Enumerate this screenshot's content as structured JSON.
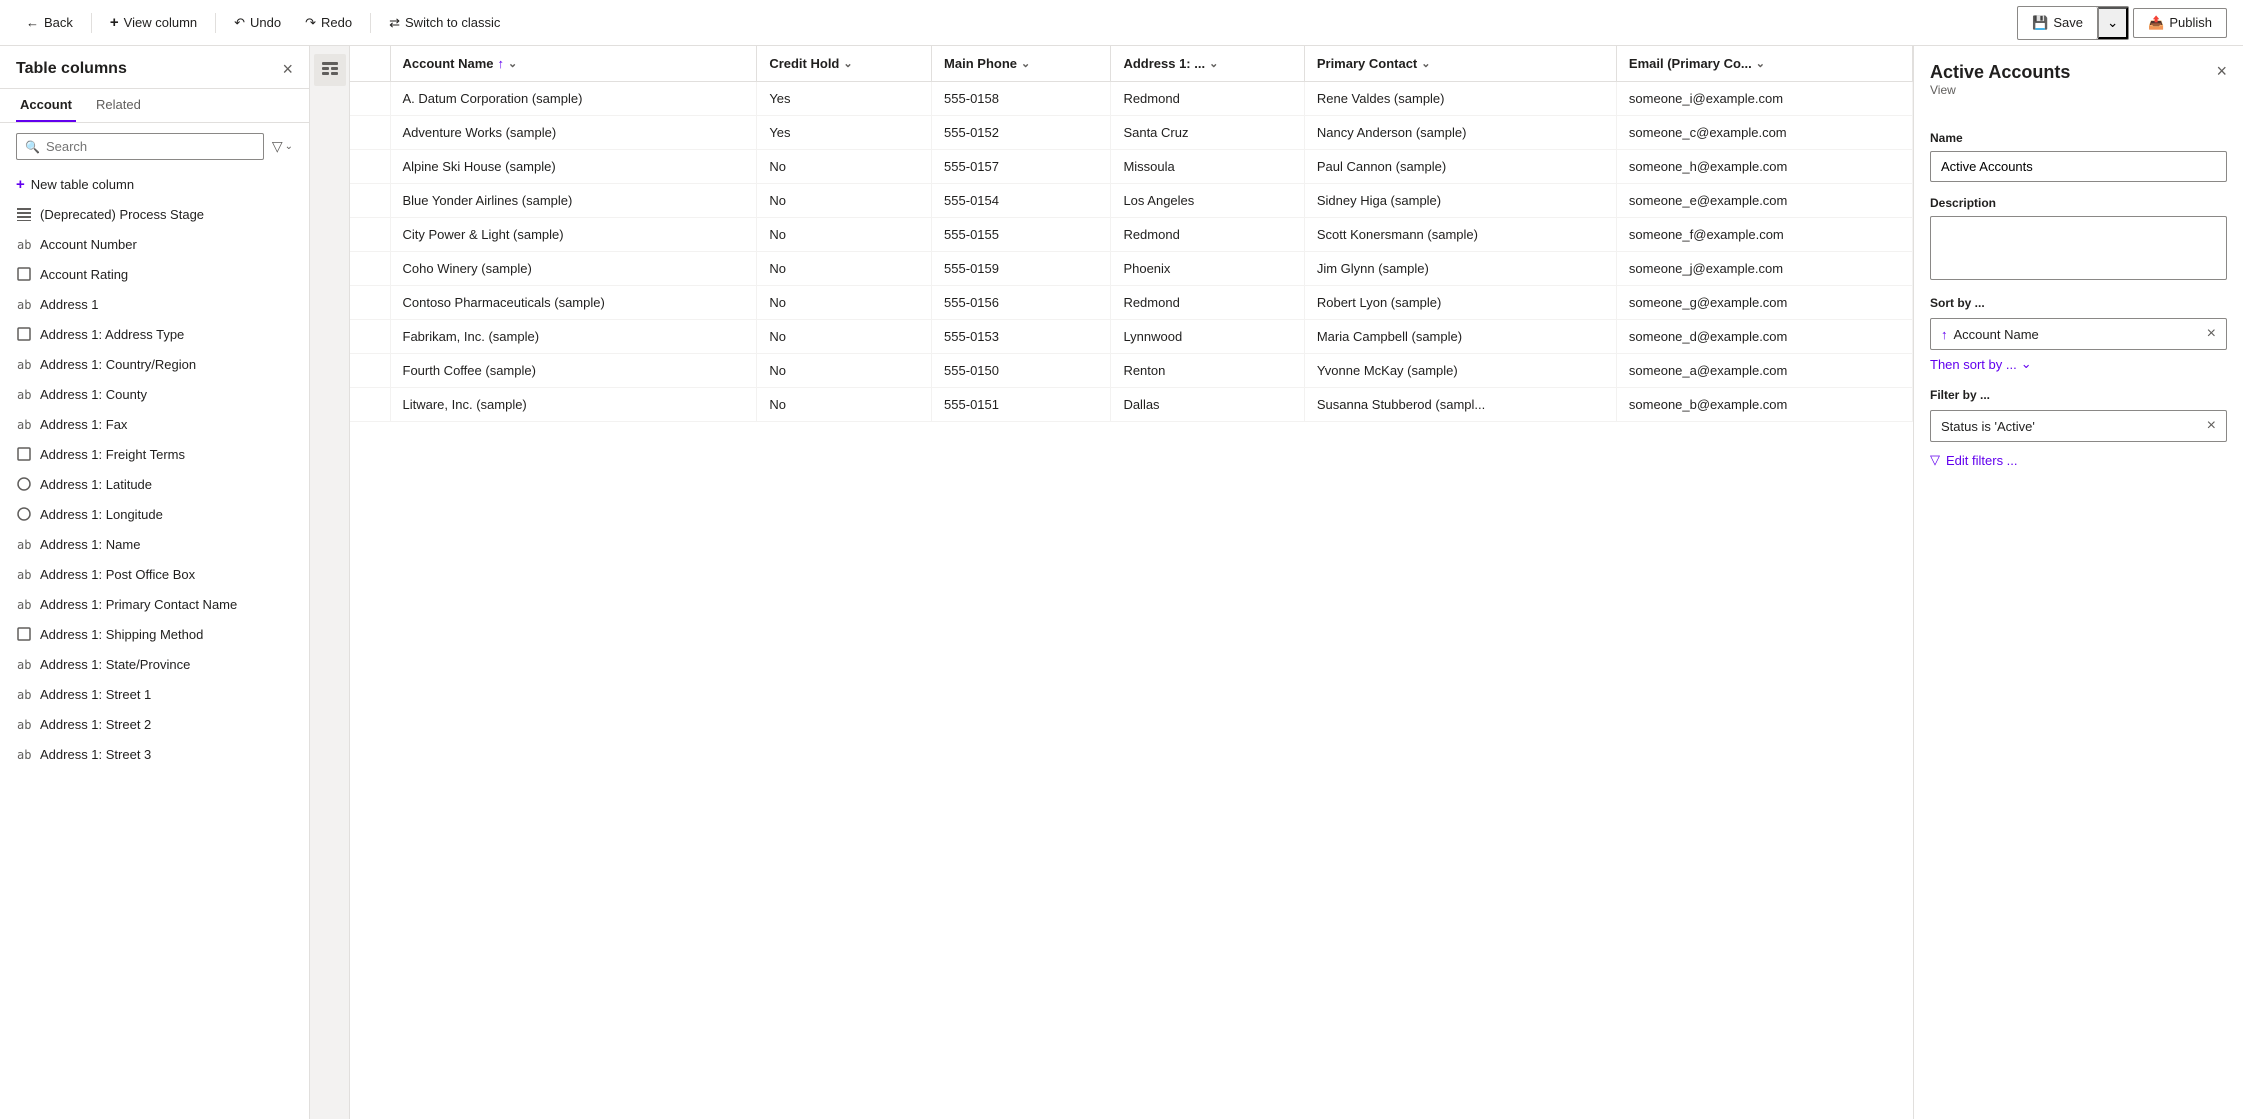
{
  "toolbar": {
    "back_label": "Back",
    "view_column_label": "View column",
    "undo_label": "Undo",
    "redo_label": "Redo",
    "switch_label": "Switch to classic",
    "save_label": "Save",
    "publish_label": "Publish"
  },
  "left_panel": {
    "title": "Table columns",
    "close_label": "×",
    "tabs": [
      {
        "id": "account",
        "label": "Account",
        "active": true
      },
      {
        "id": "related",
        "label": "Related",
        "active": false
      }
    ],
    "search_placeholder": "Search",
    "new_column_label": "New table column",
    "columns": [
      {
        "id": "col-deprecated-process",
        "icon": "list",
        "label": "(Deprecated) Process Stage"
      },
      {
        "id": "col-account-number",
        "icon": "text",
        "label": "Account Number"
      },
      {
        "id": "col-account-rating",
        "icon": "box",
        "label": "Account Rating"
      },
      {
        "id": "col-address-1",
        "icon": "text",
        "label": "Address 1"
      },
      {
        "id": "col-address-1-type",
        "icon": "box",
        "label": "Address 1: Address Type"
      },
      {
        "id": "col-address-1-country",
        "icon": "text",
        "label": "Address 1: Country/Region"
      },
      {
        "id": "col-address-1-county",
        "icon": "text",
        "label": "Address 1: County"
      },
      {
        "id": "col-address-1-fax",
        "icon": "text",
        "label": "Address 1: Fax"
      },
      {
        "id": "col-address-1-freight",
        "icon": "box",
        "label": "Address 1: Freight Terms"
      },
      {
        "id": "col-address-1-latitude",
        "icon": "circle",
        "label": "Address 1: Latitude"
      },
      {
        "id": "col-address-1-longitude",
        "icon": "circle",
        "label": "Address 1: Longitude"
      },
      {
        "id": "col-address-1-name",
        "icon": "text",
        "label": "Address 1: Name"
      },
      {
        "id": "col-address-1-pobox",
        "icon": "text",
        "label": "Address 1: Post Office Box"
      },
      {
        "id": "col-address-1-primary-contact",
        "icon": "text",
        "label": "Address 1: Primary Contact Name"
      },
      {
        "id": "col-address-1-shipping",
        "icon": "box",
        "label": "Address 1: Shipping Method"
      },
      {
        "id": "col-address-1-state",
        "icon": "text",
        "label": "Address 1: State/Province"
      },
      {
        "id": "col-address-1-street1",
        "icon": "text",
        "label": "Address 1: Street 1"
      },
      {
        "id": "col-address-1-street2",
        "icon": "text",
        "label": "Address 1: Street 2"
      },
      {
        "id": "col-address-1-street3",
        "icon": "text",
        "label": "Address 1: Street 3"
      }
    ]
  },
  "grid": {
    "columns": [
      {
        "id": "account-name",
        "label": "Account Name",
        "sort": "asc",
        "has_filter": true
      },
      {
        "id": "credit-hold",
        "label": "Credit Hold",
        "has_filter": true
      },
      {
        "id": "main-phone",
        "label": "Main Phone",
        "has_filter": true
      },
      {
        "id": "address-1",
        "label": "Address 1: ...",
        "has_filter": true
      },
      {
        "id": "primary-contact",
        "label": "Primary Contact",
        "has_filter": true
      },
      {
        "id": "email",
        "label": "Email (Primary Co...",
        "has_filter": true
      }
    ],
    "rows": [
      {
        "account_name": "A. Datum Corporation (sample)",
        "credit_hold": "Yes",
        "main_phone": "555-0158",
        "address": "Redmond",
        "primary_contact": "Rene Valdes (sample)",
        "email": "someone_i@example.com"
      },
      {
        "account_name": "Adventure Works (sample)",
        "credit_hold": "Yes",
        "main_phone": "555-0152",
        "address": "Santa Cruz",
        "primary_contact": "Nancy Anderson (sample)",
        "email": "someone_c@example.com"
      },
      {
        "account_name": "Alpine Ski House (sample)",
        "credit_hold": "No",
        "main_phone": "555-0157",
        "address": "Missoula",
        "primary_contact": "Paul Cannon (sample)",
        "email": "someone_h@example.com"
      },
      {
        "account_name": "Blue Yonder Airlines (sample)",
        "credit_hold": "No",
        "main_phone": "555-0154",
        "address": "Los Angeles",
        "primary_contact": "Sidney Higa (sample)",
        "email": "someone_e@example.com"
      },
      {
        "account_name": "City Power & Light (sample)",
        "credit_hold": "No",
        "main_phone": "555-0155",
        "address": "Redmond",
        "primary_contact": "Scott Konersmann (sample)",
        "email": "someone_f@example.com"
      },
      {
        "account_name": "Coho Winery (sample)",
        "credit_hold": "No",
        "main_phone": "555-0159",
        "address": "Phoenix",
        "primary_contact": "Jim Glynn (sample)",
        "email": "someone_j@example.com"
      },
      {
        "account_name": "Contoso Pharmaceuticals (sample)",
        "credit_hold": "No",
        "main_phone": "555-0156",
        "address": "Redmond",
        "primary_contact": "Robert Lyon (sample)",
        "email": "someone_g@example.com"
      },
      {
        "account_name": "Fabrikam, Inc. (sample)",
        "credit_hold": "No",
        "main_phone": "555-0153",
        "address": "Lynnwood",
        "primary_contact": "Maria Campbell (sample)",
        "email": "someone_d@example.com"
      },
      {
        "account_name": "Fourth Coffee (sample)",
        "credit_hold": "No",
        "main_phone": "555-0150",
        "address": "Renton",
        "primary_contact": "Yvonne McKay (sample)",
        "email": "someone_a@example.com"
      },
      {
        "account_name": "Litware, Inc. (sample)",
        "credit_hold": "No",
        "main_phone": "555-0151",
        "address": "Dallas",
        "primary_contact": "Susanna Stubberod (sampl...",
        "email": "someone_b@example.com"
      }
    ]
  },
  "right_panel": {
    "title": "Active Accounts",
    "subtitle": "View",
    "close_label": "×",
    "name_label": "Name",
    "name_value": "Active Accounts",
    "description_label": "Description",
    "description_placeholder": "",
    "sort_label": "Sort by ...",
    "sort_item": "Account Name",
    "sort_direction": "↑",
    "then_sort_label": "Then sort by ...",
    "filter_label": "Filter by ...",
    "filter_item": "Status is 'Active'",
    "edit_filters_label": "Edit filters ..."
  },
  "icons": {
    "back": "←",
    "view_column": "+",
    "undo": "↶",
    "redo": "↷",
    "switch": "⇄",
    "save": "💾",
    "publish": "📤",
    "search": "🔍",
    "filter": "▾",
    "close": "×",
    "new_col": "+",
    "sort_asc": "↑",
    "sort_desc": "↓",
    "chevron_down": "⌄",
    "shield": "⊙",
    "list_icon": "≡",
    "text_icon": "abc",
    "box_icon": "☐",
    "circle_icon": "○",
    "edit_filter": "▽"
  }
}
